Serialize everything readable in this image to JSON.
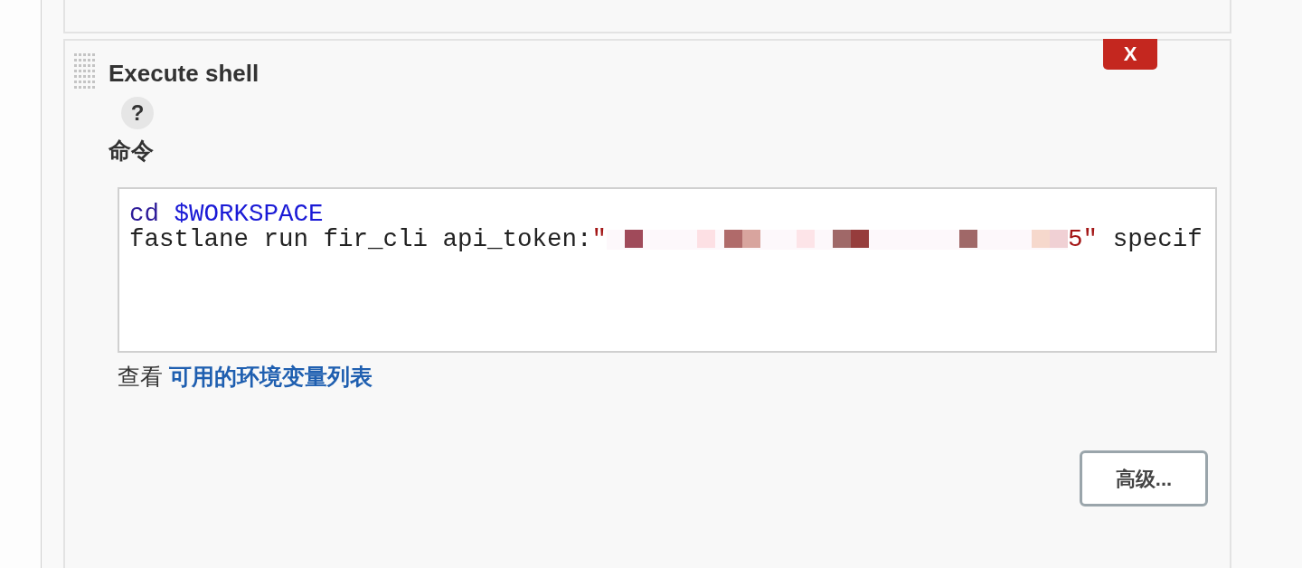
{
  "step": {
    "title": "Execute shell",
    "delete_button": "X",
    "help_button": "?",
    "field_label": "命令",
    "command_lines": [
      [
        {
          "kind": "keyword",
          "text": "cd"
        },
        {
          "kind": "space"
        },
        {
          "kind": "variable",
          "text": "$WORKSPACE"
        }
      ],
      [
        {
          "kind": "plain",
          "text": "fastlane run fir_cli api_token:"
        },
        {
          "kind": "string",
          "text": "\""
        },
        {
          "kind": "redacted"
        },
        {
          "kind": "string",
          "text": "5\""
        },
        {
          "kind": "plain",
          "text": " specif"
        }
      ]
    ],
    "hint_prefix": "查看",
    "hint_link": "可用的环境变量列表",
    "advanced_button": "高级..."
  }
}
